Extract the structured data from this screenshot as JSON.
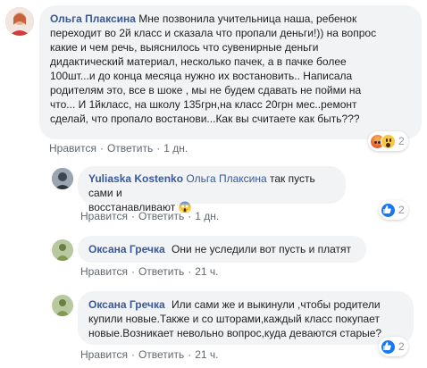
{
  "comments": [
    {
      "author": "Ольга Плаксина",
      "mention": "",
      "text": "Мне позвонила учительница наша, ребенок\nпереходит во 2й класс и сказала что пропали деньги!)) на вопрос\nкакие и чем речь, выяснилось что сувенирные деньги\nдидактический материал, несколько пачек, а в пачке более\n100шт...и до конца месяца нужно их востановить.. Написала\nродителям это, все в шоке , мы не будем сдавать не пойми на\nчто... И 1йкласс, на школу 135грн,на класс 20грн мес..ремонт\nсделай, что пропало востанови...Как вы считаете как быть???",
      "like": "Нравится",
      "reply": "Ответить",
      "time": "1 дн.",
      "reactions": [
        "angry",
        "wow"
      ],
      "reaction_count": "2"
    },
    {
      "author": "Yuliaska Kostenko",
      "mention": "Ольга Плаксина",
      "text": "так пусть сами и\nвосстанавливают 😱",
      "like": "Нравится",
      "reply": "Ответить",
      "time": "1 дн.",
      "reactions": [
        "like"
      ],
      "reaction_count": "2"
    },
    {
      "author": "Оксана Гречка",
      "mention": "",
      "text": "Они не уследили вот пусть и платят",
      "like": "Нравится",
      "reply": "Ответить",
      "time": "21 ч.",
      "reactions": [],
      "reaction_count": ""
    },
    {
      "author": "Оксана Гречка",
      "mention": "",
      "text": "Или сами же и выкинули ,чтобы родители\nкупили новые.Также и со шторами,каждый класс покупает\nновые.Возникает невольно вопрос,куда деваются старые?",
      "like": "Нравится",
      "reply": "Ответить",
      "time": "21 ч.",
      "reactions": [
        "like"
      ],
      "reaction_count": "2"
    }
  ],
  "colors": {
    "link": "#385898",
    "bubble": "#f2f3f5",
    "meta": "#606770"
  }
}
